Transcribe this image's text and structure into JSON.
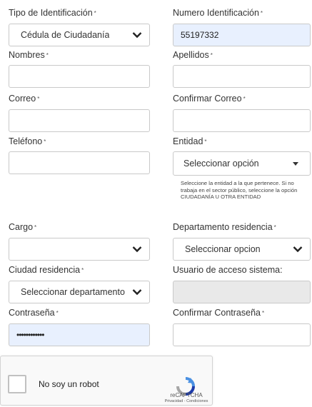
{
  "form": {
    "tipo_id": {
      "label": "Tipo de Identificación",
      "value": "Cédula de Ciudadanía"
    },
    "numero_id": {
      "label": "Numero Identificación",
      "value": "55197332"
    },
    "nombres": {
      "label": "Nombres",
      "value": ""
    },
    "apellidos": {
      "label": "Apellidos",
      "value": ""
    },
    "correo": {
      "label": "Correo",
      "value": ""
    },
    "confirmar_correo": {
      "label": "Confirmar Correo",
      "value": ""
    },
    "telefono": {
      "label": "Teléfono",
      "value": ""
    },
    "entidad": {
      "label": "Entidad",
      "value": "Seleccionar opción",
      "help": "Seleccione la entidad a la que pertenece. Si no trabaja en el sector público, seleccione la opción CIUDADANÍA U OTRA ENTIDAD"
    },
    "cargo": {
      "label": "Cargo",
      "value": ""
    },
    "departamento": {
      "label": "Departamento residencia",
      "value": "Seleccionar opcion"
    },
    "ciudad": {
      "label": "Ciudad residencia",
      "value": "Seleccionar departamento"
    },
    "usuario": {
      "label": "Usuario de acceso sistema:",
      "value": ""
    },
    "contrasena": {
      "label": "Contraseña",
      "value": "••••••••••••"
    },
    "confirmar_contrasena": {
      "label": "Confirmar Contraseña",
      "value": ""
    },
    "required_mark": "*"
  },
  "captcha": {
    "label": "No soy un robot",
    "brand": "reCAPTCHA",
    "links": "Privacidad - Condiciones"
  },
  "colors": {
    "autofill_bg": "#e8f0fe",
    "disabled_bg": "#e9e9e9",
    "border": "#c9c9c9",
    "recaptcha_blue": "#4a90e2"
  },
  "icons": [
    "chevron-down-icon",
    "caret-down-icon",
    "recaptcha-logo-icon"
  ]
}
